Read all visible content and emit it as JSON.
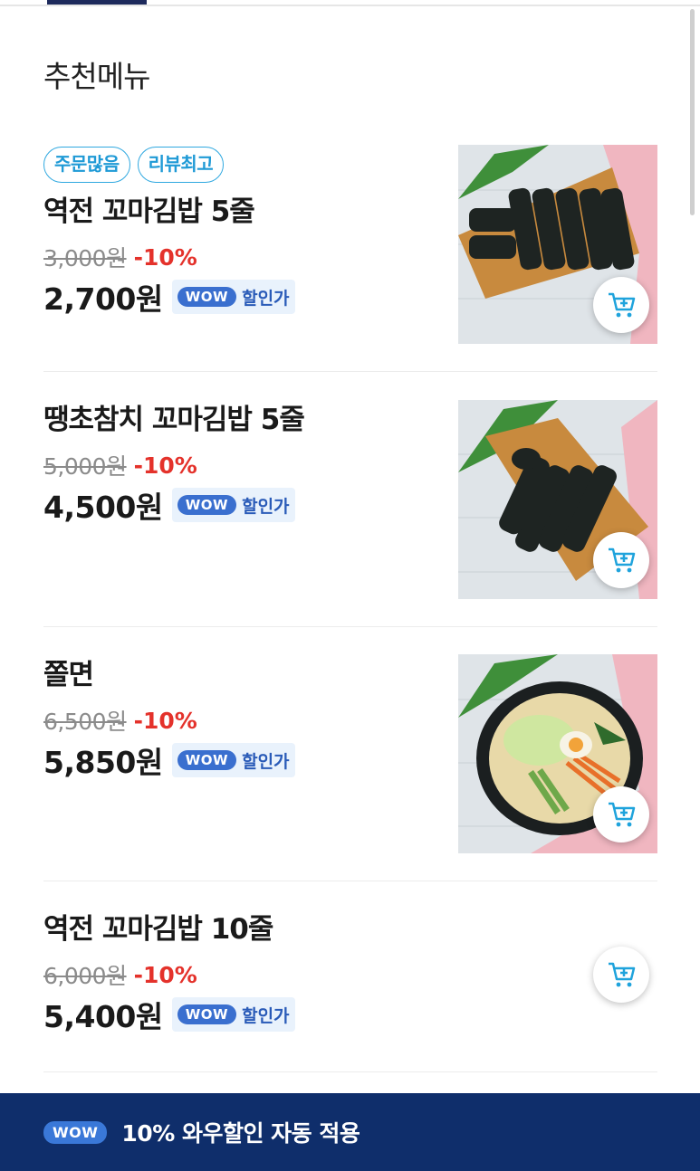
{
  "section_title": "추천메뉴",
  "currency_suffix": "원",
  "items": [
    {
      "badges": [
        "주문많음",
        "리뷰최고"
      ],
      "name": "역전 꼬마김밥 5줄",
      "original_price": "3,000원",
      "discount": "-10%",
      "final_price": "2,700원",
      "wow_badge": "WOW",
      "wow_label": "할인가",
      "has_image": true,
      "image_icon": "kimbap-photo"
    },
    {
      "badges": [],
      "name": "땡초참치 꼬마김밥 5줄",
      "original_price": "5,000원",
      "discount": "-10%",
      "final_price": "4,500원",
      "wow_badge": "WOW",
      "wow_label": "할인가",
      "has_image": true,
      "image_icon": "tuna-kimbap-photo"
    },
    {
      "badges": [],
      "name": "쫄면",
      "original_price": "6,500원",
      "discount": "-10%",
      "final_price": "5,850원",
      "wow_badge": "WOW",
      "wow_label": "할인가",
      "has_image": true,
      "image_icon": "jjolmyeon-photo"
    },
    {
      "badges": [],
      "name": "역전 꼬마김밥 10줄",
      "original_price": "6,000원",
      "discount": "-10%",
      "final_price": "5,400원",
      "wow_badge": "WOW",
      "wow_label": "할인가",
      "has_image": false,
      "image_icon": ""
    }
  ],
  "banner": {
    "wow_badge": "WOW",
    "percent": "10%",
    "text": "와우할인 자동 적용"
  },
  "colors": {
    "accent_blue": "#2fa8e0",
    "discount_red": "#e4322b",
    "banner_navy": "#0f2e6b",
    "wow_blue": "#3a6fcf"
  },
  "icons": [
    "cart-add-icon"
  ]
}
